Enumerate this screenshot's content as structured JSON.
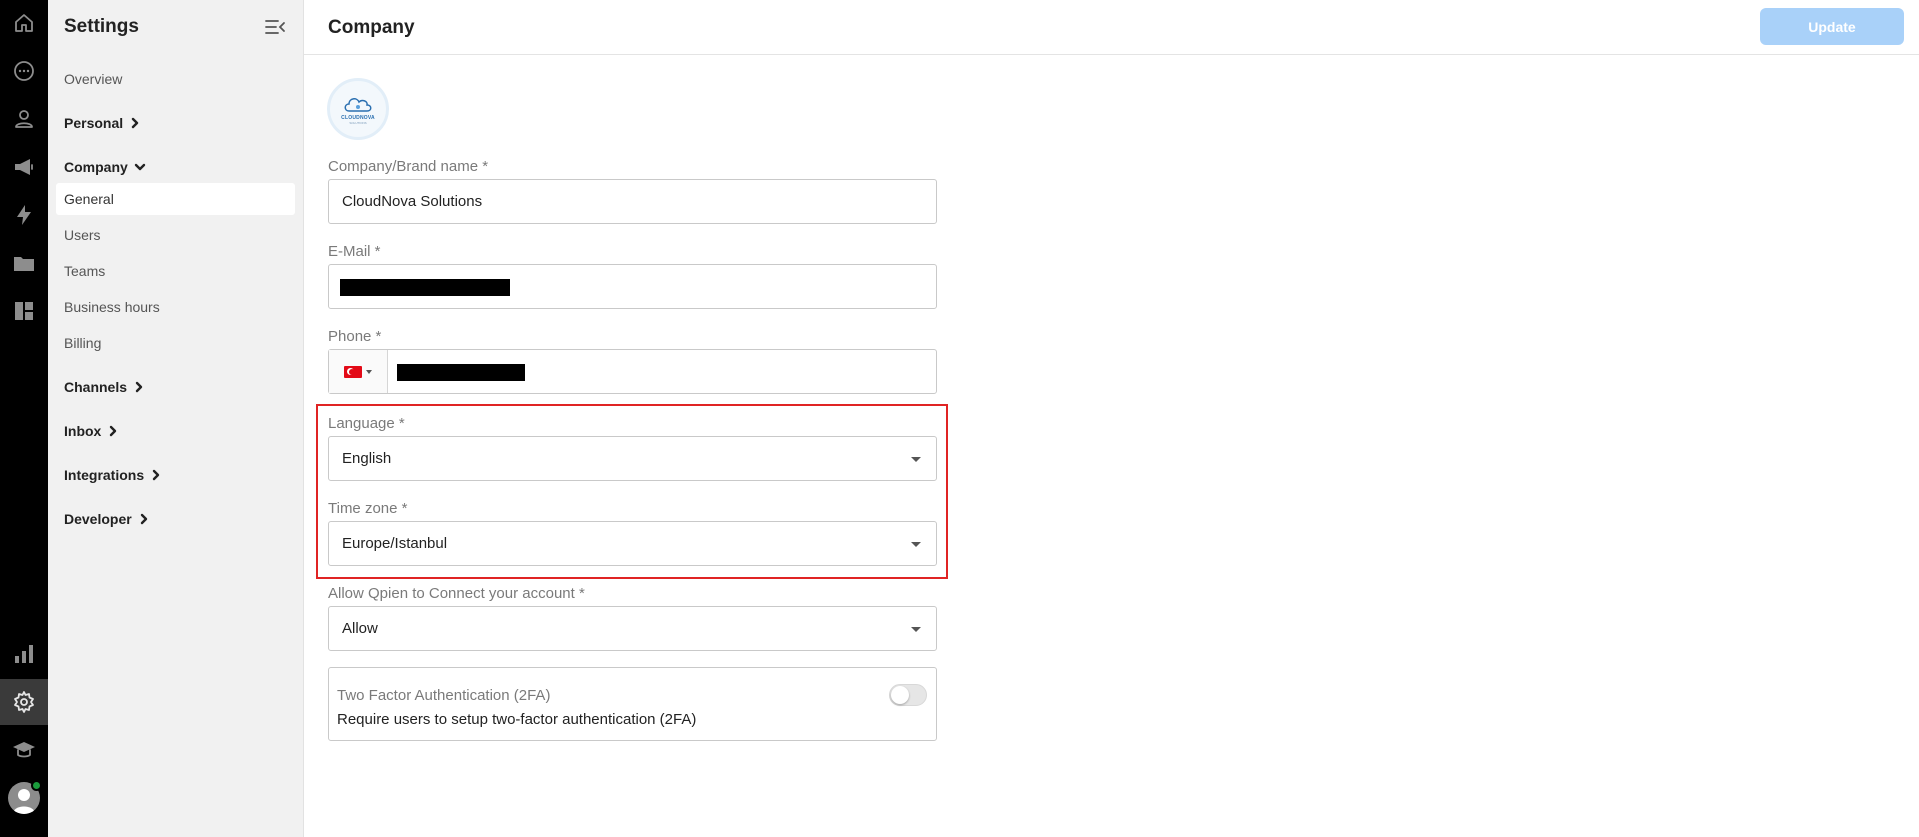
{
  "rail": {
    "items": [
      {
        "icon": "home-icon"
      },
      {
        "icon": "chat-icon"
      },
      {
        "icon": "contacts-icon"
      },
      {
        "icon": "megaphone-icon"
      },
      {
        "icon": "lightning-icon"
      },
      {
        "icon": "folder-user-icon"
      },
      {
        "icon": "dashboard-icon"
      },
      {
        "icon": "bar-chart-icon"
      },
      {
        "icon": "gear-icon",
        "active": true
      },
      {
        "icon": "graduation-cap-icon"
      }
    ],
    "status_color": "#1a9a3b"
  },
  "sidebar": {
    "title": "Settings",
    "overview": "Overview",
    "groups": {
      "personal": "Personal",
      "company": "Company",
      "channels": "Channels",
      "inbox": "Inbox",
      "integrations": "Integrations",
      "developer": "Developer"
    },
    "company_items": [
      "General",
      "Users",
      "Teams",
      "Business hours",
      "Billing"
    ],
    "active_item": "General"
  },
  "header": {
    "title": "Company",
    "update_label": "Update"
  },
  "form": {
    "logo": {
      "name": "CLOUDNOVA",
      "sub": "SOLUTIONS"
    },
    "company_name": {
      "label": "Company/Brand name *",
      "value": "CloudNova Solutions"
    },
    "email": {
      "label": "E-Mail *",
      "value_redacted": true
    },
    "phone": {
      "label": "Phone *",
      "country": "Turkey",
      "value_redacted": true
    },
    "language": {
      "label": "Language *",
      "value": "English"
    },
    "timezone": {
      "label": "Time zone *",
      "value": "Europe/Istanbul"
    },
    "allow_connect": {
      "label": "Allow Qpien to Connect your account *",
      "value": "Allow"
    },
    "twofa": {
      "title": "Two Factor Authentication (2FA)",
      "description": "Require users to setup two-factor authentication (2FA)",
      "enabled": false
    }
  },
  "colors": {
    "accent_button": "#a9d1f9",
    "highlight_border": "#e02424",
    "rail_bg": "#000000",
    "sidebar_bg": "#f1f1f1"
  }
}
